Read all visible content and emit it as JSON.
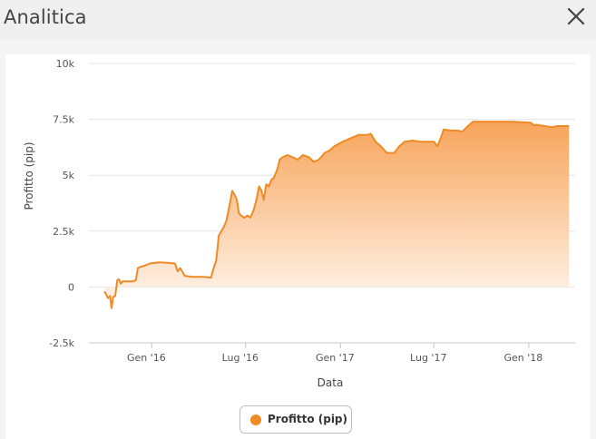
{
  "window": {
    "title": "Analitica",
    "close_icon": "close-icon"
  },
  "colors": {
    "series": "#f08a24",
    "fill_top": "#f7a45a",
    "fill_bottom": "#fff7f0",
    "grid": "#e6e6e6",
    "header_bg": "#efefef"
  },
  "legend": {
    "label": "Profitto (pip)"
  },
  "chart_data": {
    "type": "area",
    "xlabel": "Data",
    "ylabel": "Profitto (pip)",
    "ylim": [
      -2500,
      10000
    ],
    "y_ticks": [
      -2500,
      0,
      2500,
      5000,
      7500,
      10000
    ],
    "y_tick_labels": [
      "-2.5k",
      "0",
      "2.5k",
      "5k",
      "7.5k",
      "10k"
    ],
    "x_ticks": [
      "2016-01-01",
      "2016-07-01",
      "2017-01-01",
      "2017-07-01",
      "2018-01-01"
    ],
    "x_tick_labels": [
      "Gen '16",
      "Lug '16",
      "Gen '17",
      "Lug '17",
      "Gen '18"
    ],
    "xlim": [
      "2015-09-01",
      "2018-04-01"
    ],
    "grid": true,
    "legend_position": "bottom-center",
    "series": [
      {
        "name": "Profitto (pip)",
        "points": [
          [
            "2015-10-01",
            -200
          ],
          [
            "2015-10-05",
            -350
          ],
          [
            "2015-10-08",
            -500
          ],
          [
            "2015-10-12",
            -400
          ],
          [
            "2015-10-15",
            -950
          ],
          [
            "2015-10-18",
            -450
          ],
          [
            "2015-10-22",
            -400
          ],
          [
            "2015-10-26",
            300
          ],
          [
            "2015-10-29",
            350
          ],
          [
            "2015-11-02",
            150
          ],
          [
            "2015-11-06",
            250
          ],
          [
            "2015-11-15",
            250
          ],
          [
            "2015-11-25",
            250
          ],
          [
            "2015-12-01",
            300
          ],
          [
            "2015-12-05",
            850
          ],
          [
            "2015-12-10",
            900
          ],
          [
            "2015-12-18",
            950
          ],
          [
            "2015-12-28",
            1050
          ],
          [
            "2016-01-15",
            1100
          ],
          [
            "2016-02-01",
            1080
          ],
          [
            "2016-02-15",
            1050
          ],
          [
            "2016-02-20",
            700
          ],
          [
            "2016-02-25",
            850
          ],
          [
            "2016-03-05",
            500
          ],
          [
            "2016-03-20",
            450
          ],
          [
            "2016-04-10",
            450
          ],
          [
            "2016-04-25",
            420
          ],
          [
            "2016-04-28",
            700
          ],
          [
            "2016-05-05",
            1200
          ],
          [
            "2016-05-10",
            2300
          ],
          [
            "2016-05-15",
            2500
          ],
          [
            "2016-05-20",
            2700
          ],
          [
            "2016-05-25",
            3000
          ],
          [
            "2016-06-01",
            3800
          ],
          [
            "2016-06-05",
            4300
          ],
          [
            "2016-06-10",
            4100
          ],
          [
            "2016-06-14",
            3900
          ],
          [
            "2016-06-18",
            3300
          ],
          [
            "2016-06-22",
            3200
          ],
          [
            "2016-06-28",
            3100
          ],
          [
            "2016-07-05",
            3200
          ],
          [
            "2016-07-10",
            3100
          ],
          [
            "2016-07-16",
            3400
          ],
          [
            "2016-07-22",
            3900
          ],
          [
            "2016-07-27",
            4500
          ],
          [
            "2016-08-01",
            4300
          ],
          [
            "2016-08-05",
            3900
          ],
          [
            "2016-08-10",
            4600
          ],
          [
            "2016-08-15",
            4500
          ],
          [
            "2016-08-20",
            4800
          ],
          [
            "2016-08-25",
            4900
          ],
          [
            "2016-09-01",
            5300
          ],
          [
            "2016-09-05",
            5700
          ],
          [
            "2016-09-10",
            5800
          ],
          [
            "2016-09-20",
            5900
          ],
          [
            "2016-10-01",
            5800
          ],
          [
            "2016-10-10",
            5700
          ],
          [
            "2016-10-20",
            5900
          ],
          [
            "2016-11-01",
            5800
          ],
          [
            "2016-11-10",
            5600
          ],
          [
            "2016-11-20",
            5700
          ],
          [
            "2016-12-01",
            6000
          ],
          [
            "2016-12-10",
            6100
          ],
          [
            "2016-12-20",
            6300
          ],
          [
            "2017-01-05",
            6500
          ],
          [
            "2017-01-15",
            6600
          ],
          [
            "2017-01-25",
            6700
          ],
          [
            "2017-02-05",
            6800
          ],
          [
            "2017-02-20",
            6800
          ],
          [
            "2017-03-01",
            6850
          ],
          [
            "2017-03-10",
            6500
          ],
          [
            "2017-03-20",
            6300
          ],
          [
            "2017-04-01",
            6000
          ],
          [
            "2017-04-15",
            6000
          ],
          [
            "2017-04-25",
            6300
          ],
          [
            "2017-05-05",
            6500
          ],
          [
            "2017-05-20",
            6550
          ],
          [
            "2017-06-05",
            6500
          ],
          [
            "2017-06-20",
            6500
          ],
          [
            "2017-07-01",
            6500
          ],
          [
            "2017-07-08",
            6300
          ],
          [
            "2017-07-15",
            6700
          ],
          [
            "2017-07-20",
            7050
          ],
          [
            "2017-08-01",
            7000
          ],
          [
            "2017-08-15",
            7000
          ],
          [
            "2017-08-25",
            6950
          ],
          [
            "2017-09-05",
            7200
          ],
          [
            "2017-09-15",
            7400
          ],
          [
            "2017-10-01",
            7400
          ],
          [
            "2017-10-20",
            7400
          ],
          [
            "2017-11-10",
            7400
          ],
          [
            "2017-12-01",
            7400
          ],
          [
            "2017-12-15",
            7380
          ],
          [
            "2018-01-05",
            7350
          ],
          [
            "2018-01-10",
            7250
          ],
          [
            "2018-01-20",
            7250
          ],
          [
            "2018-02-01",
            7200
          ],
          [
            "2018-02-15",
            7150
          ],
          [
            "2018-02-25",
            7200
          ],
          [
            "2018-03-10",
            7200
          ],
          [
            "2018-03-20",
            7200
          ]
        ]
      }
    ]
  }
}
